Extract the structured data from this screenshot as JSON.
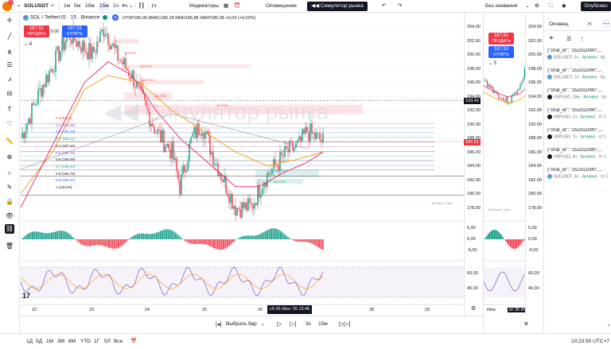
{
  "topbar": {
    "symbol": "SOLUSDT",
    "intervals": [
      "1м",
      "5м",
      "10м",
      "15м",
      "1ч",
      "4ч"
    ],
    "active_interval": "15м",
    "indicators_label": "Индикаторы",
    "alerts_label": "Оповещения",
    "replay_label": "Симулятор рынка",
    "unnamed_label": "Без названия",
    "publish_label": "Опублико",
    "avatar_badge": "11"
  },
  "legend": {
    "title": "SOL / TetherUS · 15 · Binance",
    "ohlc": "ОТКР186,06  МАКС186,18  МИН185,88  ЗАКР186,08  +0,03 (+0,02%)",
    "sell_price": "187,51",
    "sell_label": "ПРОДАТЬ",
    "spread": "0,00",
    "buy_price": "187,51",
    "buy_label": "КУПИТЬ",
    "indicator_count": "4"
  },
  "watermark": "Симулятор рынка",
  "fib_labels": [
    {
      "text": "0 (190,13)",
      "color": "#f23645"
    },
    {
      "text": "0,1 (189,46)",
      "color": "#7e57c2"
    },
    {
      "text": "0,2 (188,78)",
      "color": "#2962ff"
    },
    {
      "text": "0,3 (188,11)",
      "color": "#26a69a"
    },
    {
      "text": "0,4 (187,44)",
      "color": "#131722"
    },
    {
      "text": "0,5 (186,76)",
      "color": "#ab47bc"
    },
    {
      "text": "0,6 (186,09)",
      "color": "#131722"
    },
    {
      "text": "0,7 (185,42)",
      "color": "#26a69a"
    },
    {
      "text": "0,8 (184,75)",
      "color": "#131722"
    },
    {
      "text": "0,9 (184,07)",
      "color": "#2962ff"
    },
    {
      "text": "1 (183,40)",
      "color": "#131722"
    }
  ],
  "fvg_labels": [
    {
      "text": "4m FVG"
    },
    {
      "text": "4m FVG"
    },
    {
      "text": "4m FVG"
    },
    {
      "text": "4m FVG"
    },
    {
      "text": "1D FVG"
    },
    {
      "text": "4m FVG"
    },
    {
      "text": "4m FVG"
    }
  ],
  "price_axis": [
    "204,00",
    "202,00",
    "200,00",
    "198,00",
    "196,00",
    "194,00",
    "192,00",
    "190,00",
    "188,00",
    "186,00",
    "184,00",
    "182,00",
    "180,00",
    "178,00"
  ],
  "price_tags": {
    "high": "193,42",
    "current": "187,51"
  },
  "osc_axis": [
    "5,00",
    "0,00",
    "-5,00"
  ],
  "rsi_axis": [
    "60,00",
    "40,00"
  ],
  "time_axis": [
    "22",
    "23",
    "24",
    "25",
    "26",
    "28",
    "29"
  ],
  "time_cursor": "сб 26 Июл '25  13:45",
  "stepan_label": "@Stepan_Sam",
  "rightpanel": {
    "sell_price": "187,51",
    "sell_label": "ПРОДАТЬ",
    "buy_price": "187,51",
    "buy_label": "КУПИТЬ",
    "symbol_short": "Т",
    "price_axis": [
      "204,00",
      "202,00",
      "200,00",
      "198,00",
      "196,00",
      "194,00",
      "192,00",
      "190,00",
      "188,00",
      "186,00",
      "184,00",
      "182,00",
      "180,00",
      "178,00"
    ],
    "osc_axis": [
      "5,00",
      "0,00",
      "-5,00"
    ],
    "rsi_axis": [
      "60,00",
      "40,00"
    ],
    "time_labels": [
      "Июн",
      "вт 30 Июл '24"
    ],
    "indicator_count": "5"
  },
  "alerts": {
    "tab_alerts": "Оповещ",
    "tab_log": "Ж",
    "items": [
      {
        "title": "{\"chat_id\": \"252311090\",...",
        "symbol": "SOLUSDT",
        "tf": "1ч",
        "status": "Активно",
        "extra": "Кр",
        "color": "#131722"
      },
      {
        "title": "{\"chat_id\": \"252311090\",...",
        "symbol": "SOLUSDT",
        "tf": "1ч",
        "status": "Активно",
        "extra": "Кр",
        "color": "#131722"
      },
      {
        "title": "{\"chat_id\": \"252311090\",...",
        "symbol": "XRPUSD",
        "tf": "15м",
        "status": "Активно",
        "extra": "Кр",
        "color": "#131722"
      },
      {
        "title": "{\"chat_id\": \"252311090\",...",
        "symbol": "XRPUSD",
        "tf": "1ч",
        "status": "Активно",
        "extra": "пт 1",
        "color": "#131722"
      },
      {
        "title": "{\"chat_id\": \"252311090\",...",
        "symbol": "XRPUSD",
        "tf": "1ч",
        "status": "Активно",
        "extra": "пт 1",
        "color": "#131722"
      },
      {
        "title": "{\"chat_id\": \"252311090\",...",
        "symbol": "XRPUSD",
        "tf": "4ч",
        "status": "Активно",
        "extra": "пт 1",
        "color": "#131722"
      },
      {
        "title": "{\"chat_id\": \"252311090\",...",
        "symbol": "SOLUSDT",
        "tf": "4ч",
        "status": "Активно",
        "extra": "пт 1",
        "color": "#131722"
      }
    ]
  },
  "replay": {
    "select_bar": "Выбрать бар",
    "speed": "3x",
    "interval": "15м"
  },
  "bottombar": {
    "ranges": [
      "1Д",
      "5Д",
      "1М",
      "3М",
      "6М",
      "YTD",
      "1Г",
      "5Л",
      "Все"
    ],
    "time": "10:23:50 UTC+7"
  }
}
